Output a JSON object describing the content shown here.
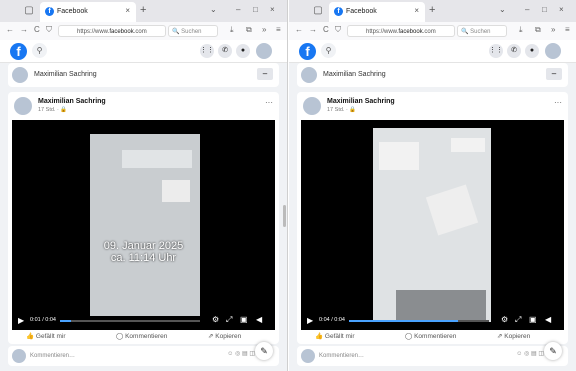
{
  "windows": [
    {
      "tab": {
        "title": "Facebook",
        "close": "×"
      },
      "newtab": "+",
      "controls": {
        "min": "–",
        "max": "□",
        "close": "×"
      },
      "toolbar": {
        "back": "←",
        "forward": "→",
        "reload": "C",
        "url_prefix": "https://www.",
        "url_domain": "facebook",
        "url_suffix": ".com",
        "search_placeholder": "Suchen"
      },
      "composer_name": "Maximilian Sachring",
      "post": {
        "author": "Maximilian Sachring",
        "meta": "17 Std. · 🔒",
        "overlay_line1": "09. Januar 2025",
        "overlay_line2": "ca. 11:14 Uhr",
        "time": "0:01 / 0:04",
        "progress": 0.08
      },
      "actions": {
        "like": "Gefällt mir",
        "comment": "Kommentieren",
        "copy": "Kopieren"
      },
      "comment_placeholder": "Kommentieren…"
    },
    {
      "tab": {
        "title": "Facebook",
        "close": "×"
      },
      "newtab": "+",
      "controls": {
        "min": "–",
        "max": "□",
        "close": "×"
      },
      "toolbar": {
        "back": "←",
        "forward": "→",
        "reload": "C",
        "url_prefix": "https://www.",
        "url_domain": "facebook",
        "url_suffix": ".com",
        "search_placeholder": "Suchen"
      },
      "composer_name": "Maximilian Sachring",
      "post": {
        "author": "Maximilian Sachring",
        "meta": "17 Std. · 🔒",
        "overlay_line1": "",
        "overlay_line2": "",
        "time": "0:04 / 0:04",
        "progress": 0.78
      },
      "actions": {
        "like": "Gefällt mir",
        "comment": "Kommentieren",
        "copy": "Kopieren"
      },
      "comment_placeholder": "Kommentieren…"
    }
  ],
  "colors": {
    "facebook_blue": "#1877f2",
    "progress": "#4aa3ff"
  }
}
